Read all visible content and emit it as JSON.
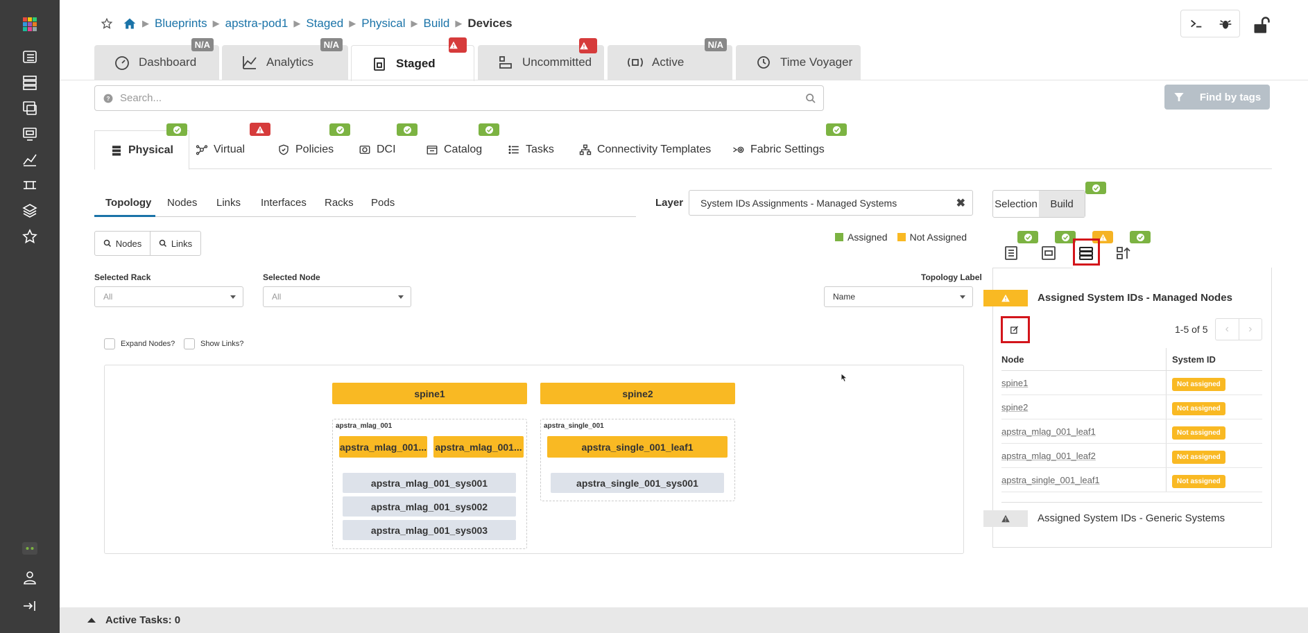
{
  "breadcrumb": [
    "Blueprints",
    "apstra-pod1",
    "Staged",
    "Physical",
    "Build"
  ],
  "breadcrumb_current": "Devices",
  "main_tabs": [
    {
      "label": "Dashboard",
      "badge": "N/A"
    },
    {
      "label": "Analytics",
      "badge": "N/A"
    },
    {
      "label": "Staged",
      "badge": "warning"
    },
    {
      "label": "Uncommitted",
      "badge": "warning"
    },
    {
      "label": "Active",
      "badge": "N/A"
    },
    {
      "label": "Time Voyager",
      "badge": ""
    }
  ],
  "search": {
    "placeholder": "Search..."
  },
  "find_tags_label": "Find by tags",
  "sub_tabs": [
    "Physical",
    "Virtual",
    "Policies",
    "DCI",
    "Catalog",
    "Tasks",
    "Connectivity Templates",
    "Fabric Settings"
  ],
  "topology_tabs": [
    "Topology",
    "Nodes",
    "Links",
    "Interfaces",
    "Racks",
    "Pods"
  ],
  "layer": {
    "label": "Layer",
    "value": "System IDs Assignments - Managed Systems"
  },
  "legend": {
    "assigned": "Assigned",
    "not_assigned": "Not Assigned",
    "assigned_color": "#7cb342",
    "not_assigned_color": "#f9b923"
  },
  "buttons": {
    "nodes": "Nodes",
    "links": "Links"
  },
  "filters": {
    "selected_rack_label": "Selected Rack",
    "selected_rack_value": "All",
    "selected_node_label": "Selected Node",
    "selected_node_value": "All",
    "topology_label_label": "Topology Label",
    "topology_label_value": "Name"
  },
  "checkboxes": {
    "expand_nodes": "Expand Nodes?",
    "show_links": "Show Links?"
  },
  "topology": {
    "spines": [
      "spine1",
      "spine2"
    ],
    "racks": [
      {
        "name": "apstra_mlag_001",
        "leaves": [
          "apstra_mlag_001...",
          "apstra_mlag_001..."
        ],
        "systems": [
          "apstra_mlag_001_sys001",
          "apstra_mlag_001_sys002",
          "apstra_mlag_001_sys003"
        ]
      },
      {
        "name": "apstra_single_001",
        "leaves": [
          "apstra_single_001_leaf1"
        ],
        "systems": [
          "apstra_single_001_sys001"
        ]
      }
    ]
  },
  "right_panel": {
    "tab_selection": "Selection",
    "tab_build": "Build",
    "section1_title": "Assigned System IDs - Managed Nodes",
    "pager": "1-5 of 5",
    "col_node": "Node",
    "col_system_id": "System ID",
    "rows": [
      {
        "node": "spine1",
        "system_id": "Not assigned"
      },
      {
        "node": "spine2",
        "system_id": "Not assigned"
      },
      {
        "node": "apstra_mlag_001_leaf1",
        "system_id": "Not assigned"
      },
      {
        "node": "apstra_mlag_001_leaf2",
        "system_id": "Not assigned"
      },
      {
        "node": "apstra_single_001_leaf1",
        "system_id": "Not assigned"
      }
    ],
    "section2_title": "Assigned System IDs - Generic Systems"
  },
  "footer": {
    "active_tasks": "Active Tasks: 0"
  }
}
